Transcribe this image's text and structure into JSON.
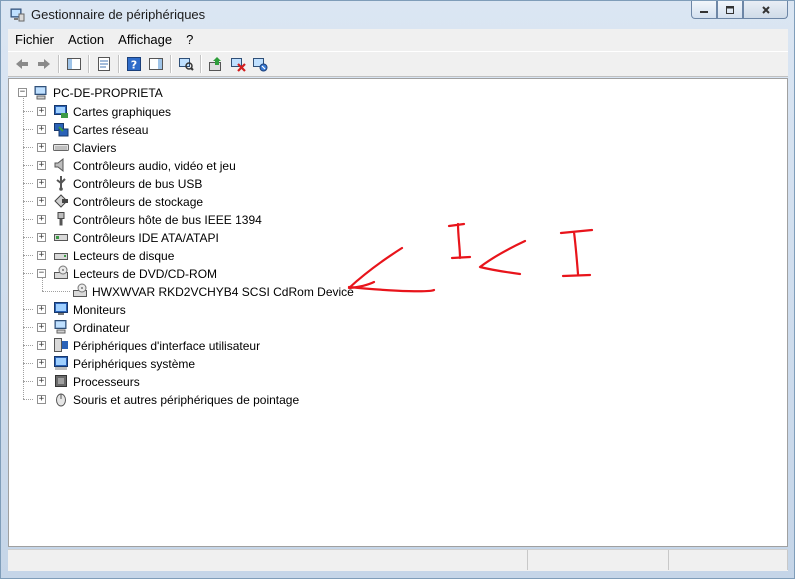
{
  "window": {
    "title": "Gestionnaire de périphériques",
    "controls": [
      "minimize-icon",
      "restore-icon",
      "close-icon"
    ]
  },
  "menu": {
    "items": [
      "Fichier",
      "Action",
      "Affichage",
      "?"
    ]
  },
  "toolbar": {
    "buttons": [
      "back-icon",
      "forward-icon",
      "show-hide-console-tree-icon",
      "properties-icon",
      "help-icon",
      "toggle-action-pane-icon",
      "scan-hardware-icon",
      "update-driver-icon",
      "uninstall-icon",
      "disable-icon"
    ]
  },
  "tree": {
    "root": {
      "label": "PC-DE-PROPRIETA",
      "icon": "computer-icon",
      "expanded": true
    },
    "items": [
      {
        "label": "Cartes graphiques",
        "icon": "display-adapter-icon",
        "expanded": false
      },
      {
        "label": "Cartes réseau",
        "icon": "network-adapter-icon",
        "expanded": false
      },
      {
        "label": "Claviers",
        "icon": "keyboard-icon",
        "expanded": false
      },
      {
        "label": "Contrôleurs audio, vidéo et jeu",
        "icon": "speaker-icon",
        "expanded": false
      },
      {
        "label": "Contrôleurs de bus USB",
        "icon": "usb-icon",
        "expanded": false
      },
      {
        "label": "Contrôleurs de stockage",
        "icon": "storage-controller-icon",
        "expanded": false
      },
      {
        "label": "Contrôleurs hôte de bus IEEE 1394",
        "icon": "firewire-icon",
        "expanded": false
      },
      {
        "label": "Contrôleurs IDE ATA/ATAPI",
        "icon": "ide-controller-icon",
        "expanded": false
      },
      {
        "label": "Lecteurs de disque",
        "icon": "disk-drive-icon",
        "expanded": false
      },
      {
        "label": "Lecteurs de DVD/CD-ROM",
        "icon": "dvd-drive-icon",
        "expanded": true,
        "children": [
          {
            "label": "HWXWVAR RKD2VCHYB4 SCSI CdRom Device",
            "icon": "dvd-drive-icon"
          }
        ]
      },
      {
        "label": "Moniteurs",
        "icon": "monitor-icon",
        "expanded": false
      },
      {
        "label": "Ordinateur",
        "icon": "computer-icon",
        "expanded": false
      },
      {
        "label": "Périphériques d'interface utilisateur",
        "icon": "hid-icon",
        "expanded": false
      },
      {
        "label": "Périphériques système",
        "icon": "system-devices-icon",
        "expanded": false
      },
      {
        "label": "Processeurs",
        "icon": "processor-icon",
        "expanded": false
      },
      {
        "label": "Souris et autres périphériques de pointage",
        "icon": "mouse-icon",
        "expanded": false
      }
    ]
  },
  "annotation": {
    "text": "ICI",
    "color": "#e8141b"
  },
  "colors": {
    "annotation": "#e8141b",
    "window_frame": "#c5d5e8",
    "tree_background": "#ffffff"
  }
}
